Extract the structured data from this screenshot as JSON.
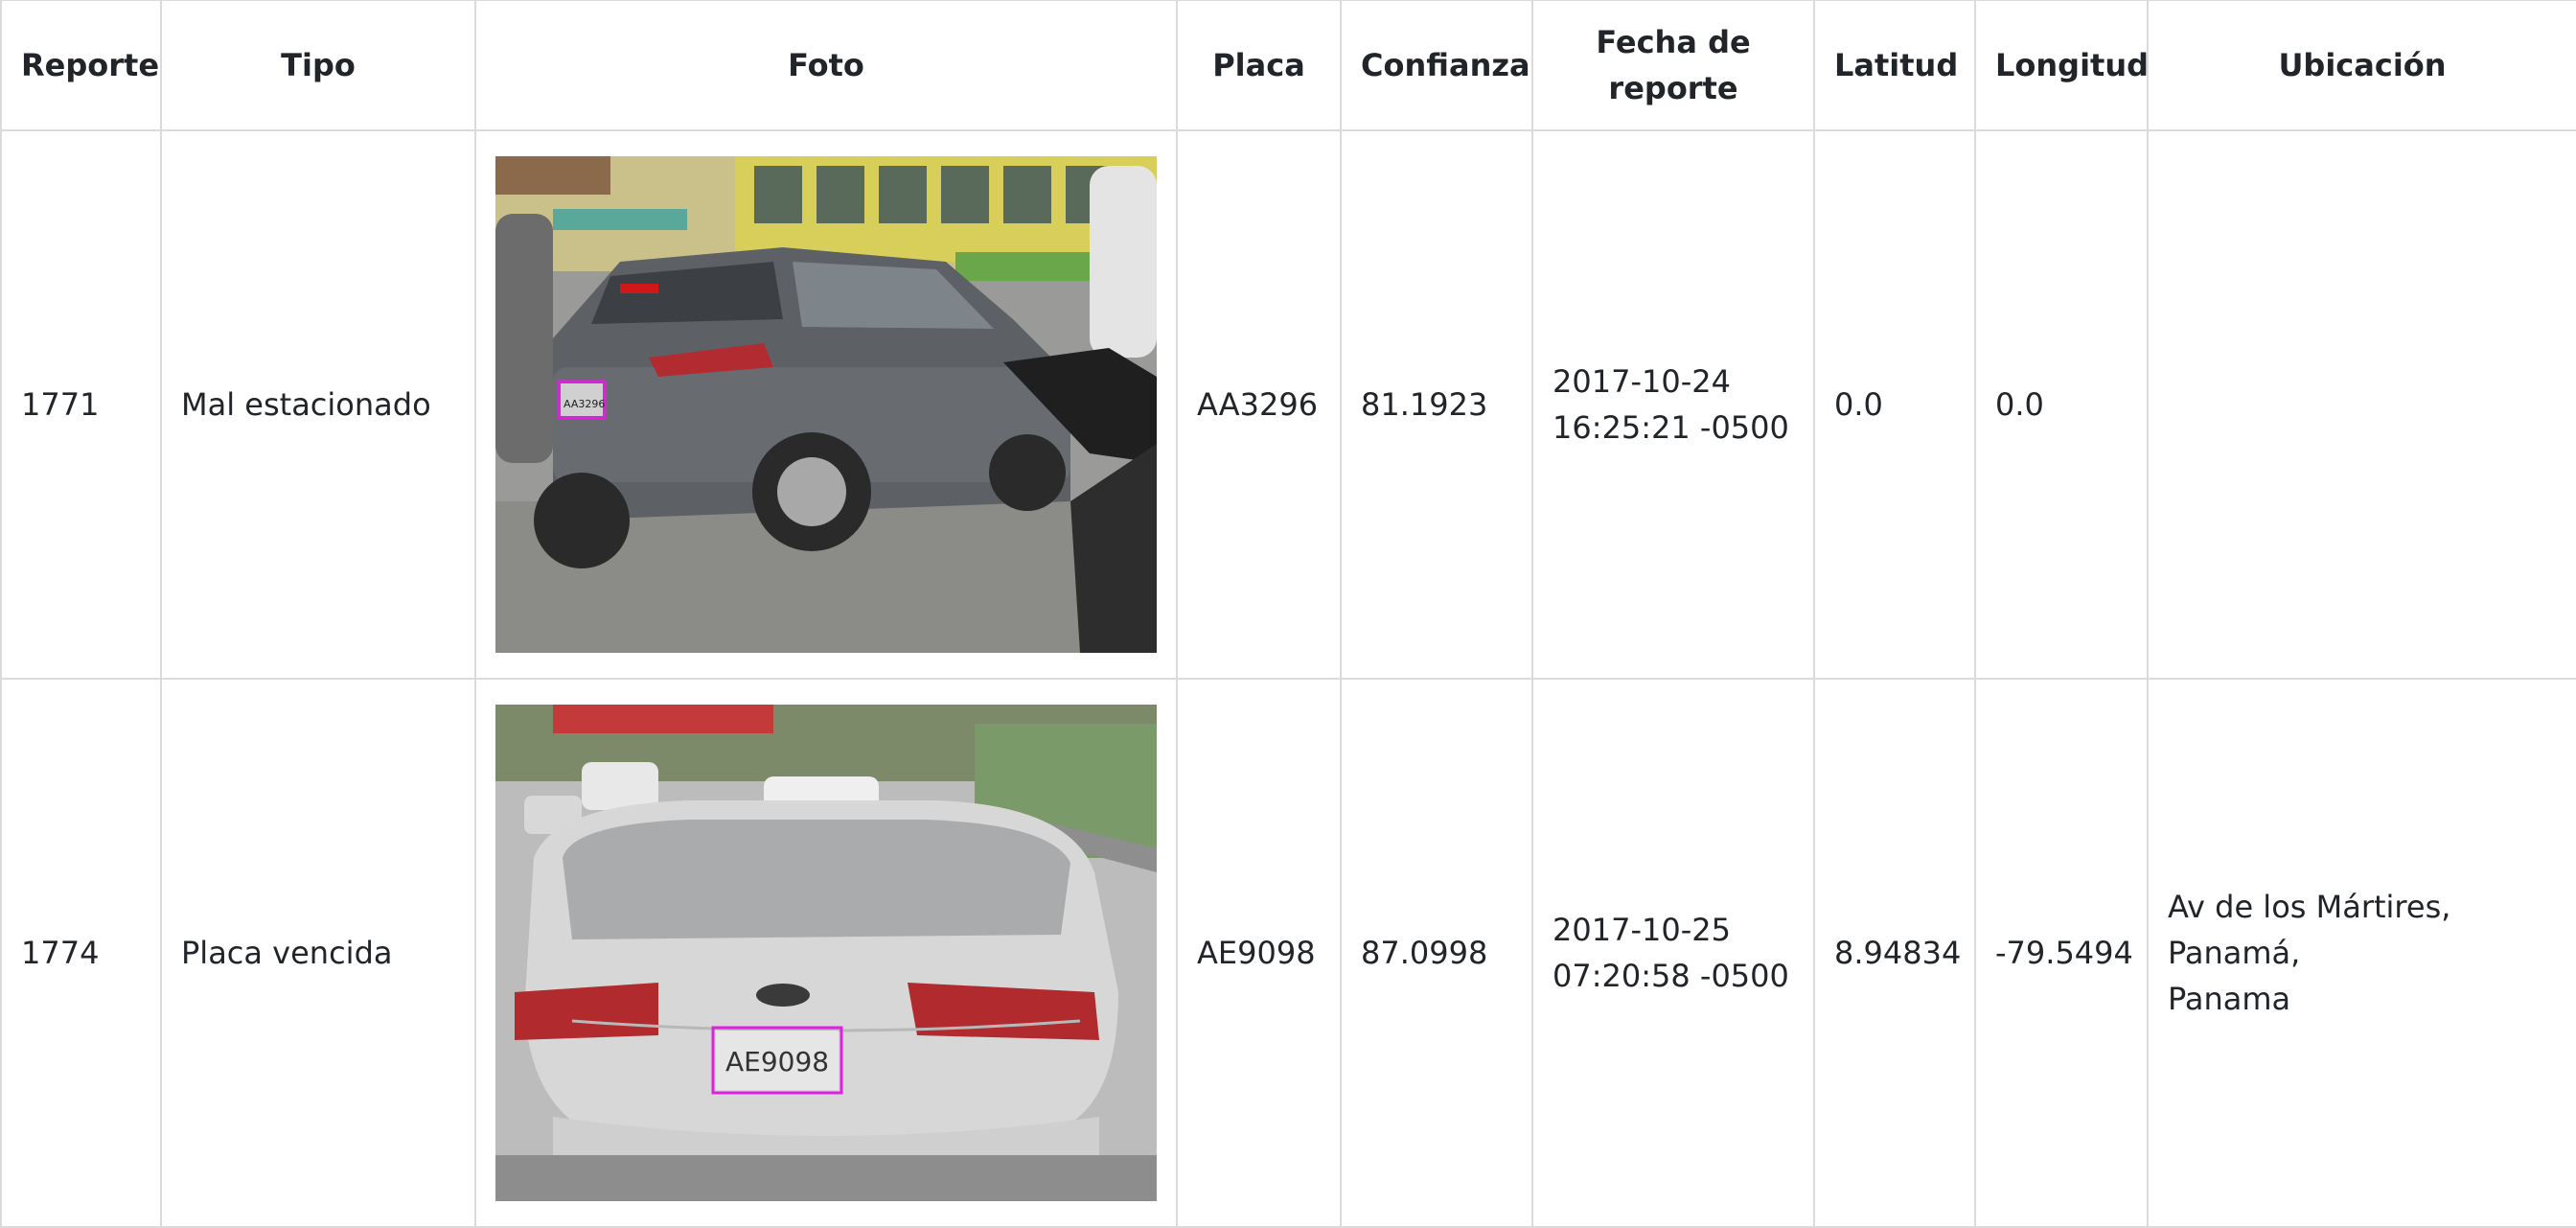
{
  "columns": {
    "reporte": "Reporte",
    "tipo": "Tipo",
    "foto": "Foto",
    "placa": "Placa",
    "confianza": "Confianza",
    "fecha_line1": "Fecha de",
    "fecha_line2": "reporte",
    "latitud": "Latitud",
    "longitud": "Longitud",
    "ubicacion": "Ubicación"
  },
  "rows": [
    {
      "reporte": "1771",
      "tipo": "Mal estacionado",
      "photo_desc": "gray-suv-photo",
      "plate_in_photo": "AA3296",
      "placa": "AA3296",
      "confianza": "81.1923",
      "fecha_line1": "2017-10-24",
      "fecha_line2": "16:25:21 -0500",
      "latitud": "0.0",
      "longitud": "0.0",
      "ubicacion_line1": "",
      "ubicacion_line2": ""
    },
    {
      "reporte": "1774",
      "tipo": "Placa vencida",
      "photo_desc": "white-sedan-photo",
      "plate_in_photo": "AE9098",
      "placa": "AE9098",
      "confianza": "87.0998",
      "fecha_line1": "2017-10-25",
      "fecha_line2": "07:20:58 -0500",
      "latitud": "8.94834",
      "longitud": "-79.5494",
      "ubicacion_line1": "Av de los Mártires, Panamá,",
      "ubicacion_line2": "Panama"
    }
  ],
  "colors": {
    "border": "#dadada",
    "plate_box": "#e020e0"
  }
}
